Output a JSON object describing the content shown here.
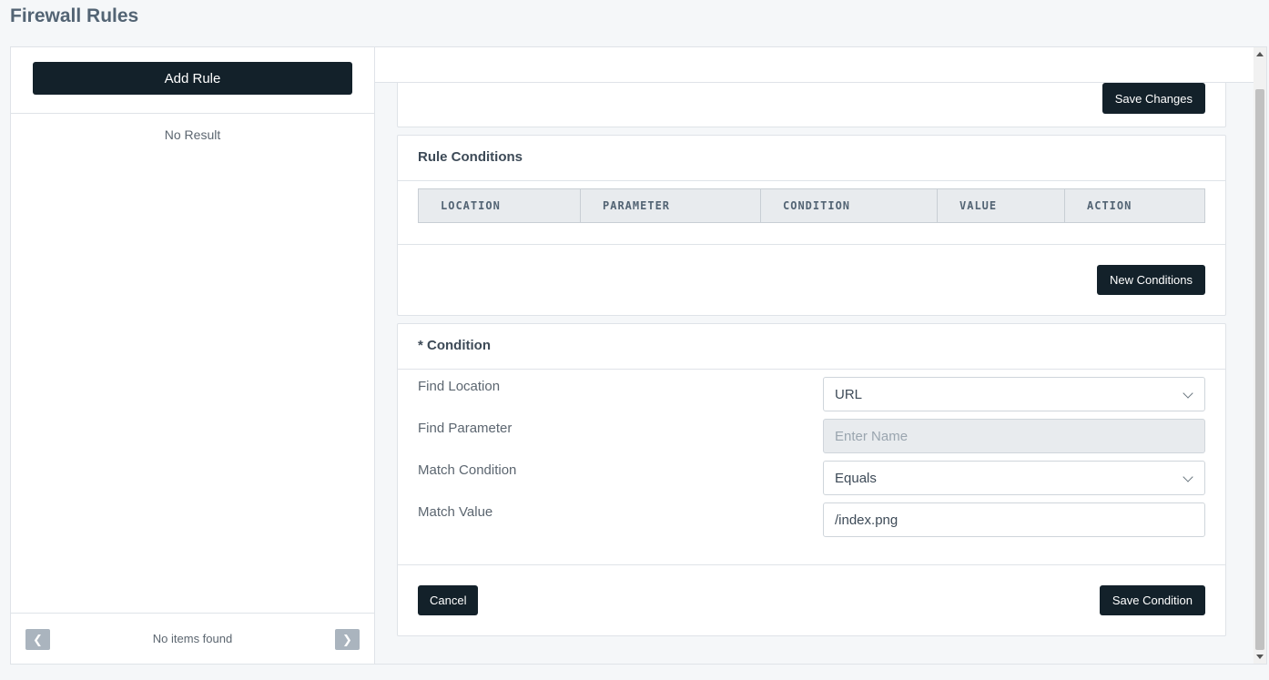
{
  "page": {
    "title": "Firewall Rules"
  },
  "left_panel": {
    "add_rule_label": "Add Rule",
    "empty_text": "No Result",
    "footer_text": "No items found",
    "prev_icon": "chevron-left-icon",
    "next_icon": "chevron-right-icon"
  },
  "top_card": {
    "save_label": "Save Changes"
  },
  "rule_conditions": {
    "title": "Rule Conditions",
    "columns": [
      "LOCATION",
      "PARAMETER",
      "CONDITION",
      "VALUE",
      "ACTION"
    ],
    "new_conditions_label": "New Conditions"
  },
  "condition_form": {
    "title": "* Condition",
    "find_location": {
      "label": "Find Location",
      "value": "URL"
    },
    "find_parameter": {
      "label": "Find Parameter",
      "placeholder": "Enter Name"
    },
    "match_condition": {
      "label": "Match Condition",
      "value": "Equals"
    },
    "match_value": {
      "label": "Match Value",
      "value": "/index.png"
    },
    "cancel_label": "Cancel",
    "save_label": "Save Condition"
  },
  "colors": {
    "primary_button": "#13212a",
    "page_bg": "#f5f7f9",
    "pager_button": "#aab4be"
  }
}
